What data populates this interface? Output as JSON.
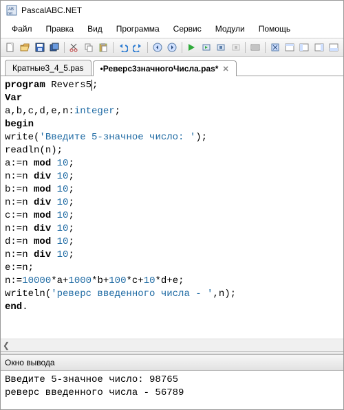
{
  "titlebar": {
    "app_name": "PascalABC.NET"
  },
  "menubar": {
    "items": [
      "Файл",
      "Правка",
      "Вид",
      "Программа",
      "Сервис",
      "Модули",
      "Помощь"
    ]
  },
  "toolbar": {
    "icons": [
      "new-file-icon",
      "open-file-icon",
      "save-icon",
      "save-all-icon",
      "sep",
      "cut-icon",
      "copy-icon",
      "paste-icon",
      "sep",
      "undo-icon",
      "redo-icon",
      "sep",
      "nav-back-icon",
      "nav-forward-icon",
      "sep",
      "run-icon",
      "run-step-icon",
      "compile-icon",
      "stop-icon",
      "sep",
      "window-list-icon",
      "sep",
      "window-new-icon",
      "browser-icon",
      "panel1-icon",
      "panel2-icon",
      "panel3-icon"
    ]
  },
  "tabs": [
    {
      "label": "Кратные3_4_5.pas",
      "active": false
    },
    {
      "label": "•Реверс3значногоЧисла.pas*",
      "active": true
    }
  ],
  "code": {
    "program_kw": "program",
    "program_name": "Revers5",
    "var_kw": "Var",
    "vars_left": "a,b,c,d,e,n:",
    "int_type": "integer",
    "begin_kw": "begin",
    "write_fn": "write",
    "write_str": "'Введите 5-значное число: '",
    "readln_fn": "readln",
    "readln_arg": "(n);",
    "mod_kw": "mod",
    "div_kw": "div",
    "ten": "10",
    "a_assign": "a:=n ",
    "n_assign": "n:=n ",
    "b_assign": "b:=n ",
    "c_assign": "c:=n ",
    "d_assign": "d:=n ",
    "e_assign": "e:=n;",
    "n_calc_left": "n:=",
    "n_calc_10000": "10000",
    "n_calc_mul_a": "*a+",
    "n_calc_1000": "1000",
    "n_calc_mul_b": "*b+",
    "n_calc_100": "100",
    "n_calc_mul_c": "*c+",
    "n_calc_10": "10",
    "n_calc_mul_de": "*d+e;",
    "writeln_fn": "writeln",
    "writeln_str": "'реверс введенного числа - '",
    "writeln_tail": ",n);",
    "end_kw": "end",
    "dot": "."
  },
  "output_panel": {
    "title": "Окно вывода",
    "line1": "Введите 5-значное число: 98765",
    "line2": "реверс введенного числа - 56789"
  },
  "colors": {
    "keyword": "#000000",
    "type_num_str": "#1e6aa3",
    "bg": "#ffffff"
  }
}
